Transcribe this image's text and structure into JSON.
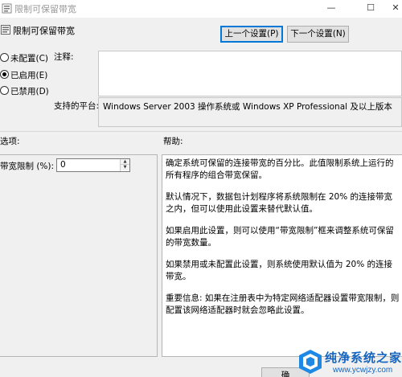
{
  "window": {
    "title": "限制可保留带宽",
    "minimize_glyph": "—",
    "maximize_glyph": "☐",
    "close_glyph": "✕"
  },
  "header": {
    "policy_name": "限制可保留带宽",
    "prev_button": "上一个设置(P)",
    "next_button": "下一个设置(N)"
  },
  "state_options": [
    {
      "label": "未配置(C)",
      "checked": false
    },
    {
      "label": "已启用(E)",
      "checked": true
    },
    {
      "label": "已禁用(D)",
      "checked": false
    }
  ],
  "comment": {
    "label": "注释:",
    "value": ""
  },
  "supported_on": {
    "label": "支持的平台:",
    "value": "Windows Server 2003 操作系统或 Windows XP Professional 及以上版本"
  },
  "options": {
    "label": "选项:",
    "bandwidth_label": "带宽限制 (%):",
    "bandwidth_value": "0",
    "spin_up_glyph": "▲",
    "spin_down_glyph": "▼"
  },
  "help": {
    "label": "帮助:",
    "paragraphs": [
      "确定系统可保留的连接带宽的百分比。此值限制系统上运行的所有程序的组合带宽保留。",
      "默认情况下，数据包计划程序将系统限制在 20% 的连接带宽之内，但可以使用此设置来替代默认值。",
      "如果启用此设置，则可以使用“带宽限制”框来调整系统可保留的带宽数量。",
      "如果禁用或未配置此设置，则系统使用默认值为 20% 的连接带宽。",
      "重要信息: 如果在注册表中为特定网络适配器设置带宽限制，则配置该网络适配器时就会忽略此设置。"
    ]
  },
  "footer": {
    "ok_button": "确"
  },
  "watermark": {
    "title": "纯净系统之家",
    "url": "www.ycwjzy.com"
  },
  "colors": {
    "accent": "#0078d7",
    "watermark_blue": "#1565c0"
  }
}
